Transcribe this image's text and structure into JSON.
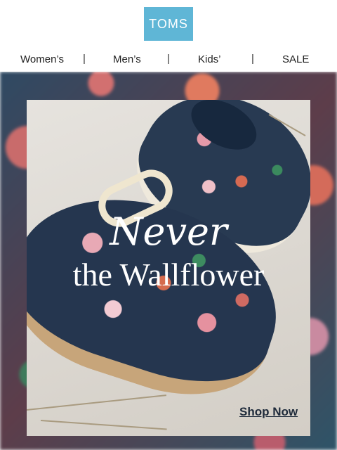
{
  "brand": {
    "logo_text": "TOMS",
    "logo_color": "#5fb6d6"
  },
  "nav": {
    "items": [
      {
        "label": "Women’s"
      },
      {
        "label": "Men’s"
      },
      {
        "label": "Kids’"
      },
      {
        "label": "SALE"
      }
    ],
    "separator": "|"
  },
  "hero": {
    "headline_line1": "Never",
    "headline_line2": "the Wallflower",
    "cta_label": "Shop Now"
  }
}
